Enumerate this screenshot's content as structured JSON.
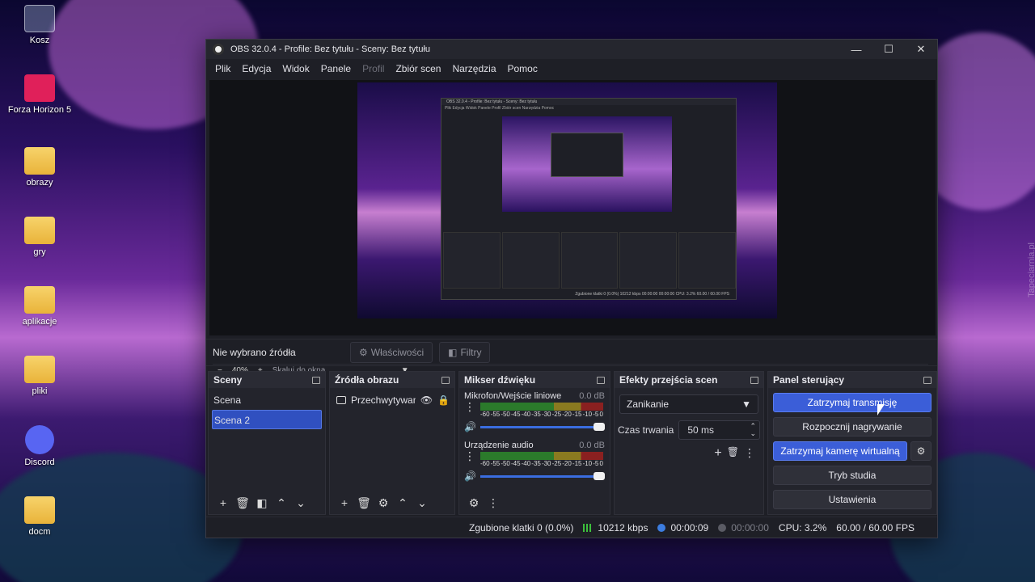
{
  "desktop": {
    "icons": [
      {
        "label": "Kosz",
        "icon": "recycle-bin-icon"
      },
      {
        "label": "Forza Horizon 5",
        "icon": "forza-icon"
      },
      {
        "label": "obrazy",
        "icon": "folder-icon"
      },
      {
        "label": "gry",
        "icon": "folder-icon"
      },
      {
        "label": "aplikacje",
        "icon": "folder-icon"
      },
      {
        "label": "pliki",
        "icon": "folder-icon"
      },
      {
        "label": "Discord",
        "icon": "discord-icon"
      },
      {
        "label": "docm",
        "icon": "folder-icon"
      }
    ],
    "watermark": "Tapeciarnia.pl"
  },
  "window": {
    "title": "OBS 32.0.4 - Profile: Bez tytułu - Sceny: Bez tytułu",
    "controls": {
      "minimize": "—",
      "maximize": "☐",
      "close": "✕"
    }
  },
  "menu": [
    "Plik",
    "Edycja",
    "Widok",
    "Panele",
    "Profil",
    "Zbiór scen",
    "Narzędzia",
    "Pomoc"
  ],
  "zoom": {
    "minus": "−",
    "level": "40%",
    "plus": "+",
    "scale_mode": "Skaluj do okna"
  },
  "source_toolbar": {
    "no_source": "Nie wybrano źródła",
    "properties": "Właściwości",
    "filters": "Filtry"
  },
  "scenes": {
    "title": "Sceny",
    "items": [
      "Scena",
      "Scena 2"
    ],
    "selected": "Scena 2"
  },
  "sources": {
    "title": "Źródła obrazu",
    "items": [
      {
        "name": "Przechwytywan"
      }
    ]
  },
  "mixer": {
    "title": "Mikser dźwięku",
    "scale": [
      "-60",
      "-55",
      "-50",
      "-45",
      "-40",
      "-35",
      "-30",
      "-25",
      "-20",
      "-15",
      "-10",
      "-5",
      "0"
    ],
    "channels": [
      {
        "name": "Mikrofon/Wejście liniowe",
        "db": "0.0 dB"
      },
      {
        "name": "Urządzenie audio",
        "db": "0.0 dB"
      }
    ]
  },
  "transitions": {
    "title": "Efekty przejścia scen",
    "selected": "Zanikanie",
    "duration_label": "Czas trwania",
    "duration_value": "50 ms"
  },
  "controls": {
    "title": "Panel sterujący",
    "stop_stream": "Zatrzymaj transmisję",
    "start_record": "Rozpocznij nagrywanie",
    "stop_vcam": "Zatrzymaj kamerę wirtualną",
    "studio_mode": "Tryb studia",
    "settings": "Ustawienia"
  },
  "status": {
    "dropped_frames": "Zgubione klatki 0 (0.0%)",
    "bitrate": "10212 kbps",
    "stream_time": "00:00:09",
    "record_time": "00:00:00",
    "cpu": "CPU: 3.2%",
    "fps": "60.00 / 60.00 FPS"
  },
  "nested_preview": {
    "title": "OBS 32.0.4 - Profile: Bez tytułu - Sceny: Bez tytułu",
    "status": "Zgubione klatki 0 (0.0%)   10212 kbps   00:00:00   00:00:00   CPU: 3.2%   60.00 / 60.00 FPS"
  },
  "colors": {
    "accent": "#3b5ed8",
    "selection": "#3050c0",
    "stream_dot": "#3c7de0",
    "bitrate_bars": "#3cc03c"
  }
}
